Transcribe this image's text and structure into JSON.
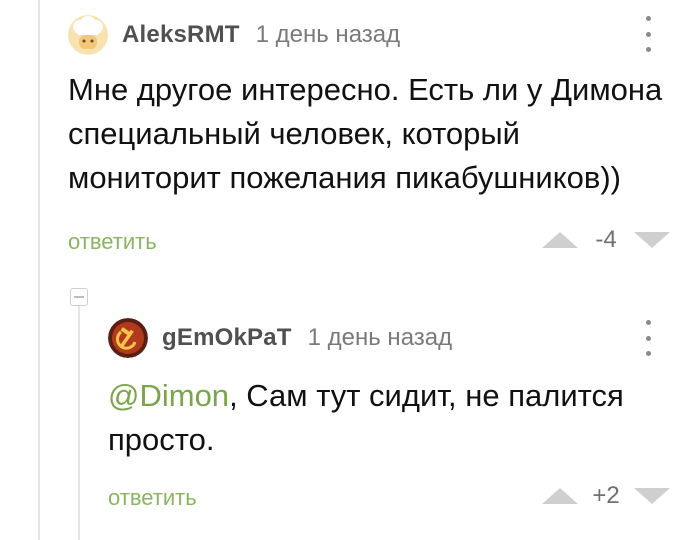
{
  "comments": [
    {
      "username": "AleksRMT",
      "timestamp": "1 день назад",
      "text": "Мне другое интересно. Есть ли у Димона специальный человек, который мониторит пожелания пикабушников))",
      "reply_label": "ответить",
      "rating": "-4",
      "avatar_icon": "chef-avatar-icon"
    },
    {
      "username": "gEmOkPaT",
      "timestamp": "1 день назад",
      "mention": "@Dimon",
      "text": ", Сам тут сидит, не палится просто.",
      "reply_label": "ответить",
      "rating": "+2",
      "avatar_icon": "hammer-sickle-avatar-icon"
    }
  ],
  "colors": {
    "accent_green": "#8ab560",
    "mention_green": "#7aa64a",
    "vote_arrow": "#cfcfcf",
    "thread_line": "#e6e6e6"
  }
}
